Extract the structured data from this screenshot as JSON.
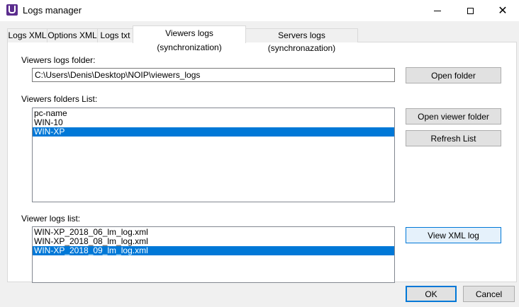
{
  "window": {
    "title": "Logs manager",
    "controls": {
      "minimize": "minimize",
      "maximize": "maximize",
      "close": "✕"
    }
  },
  "tabs": [
    {
      "label": "Logs XML"
    },
    {
      "label": "Options XML"
    },
    {
      "label": "Logs txt"
    },
    {
      "label": "Viewers logs (synchronization)",
      "active": true
    },
    {
      "label": "Servers logs (synchronazation)"
    }
  ],
  "viewers_tab": {
    "folder_label": "Viewers logs folder:",
    "folder_path": "C:\\Users\\Denis\\Desktop\\NOIP\\viewers_logs",
    "open_folder_button": "Open folder",
    "folders_list_label": "Viewers folders List:",
    "folders": [
      "pc-name",
      "WIN-10",
      "WIN-XP"
    ],
    "selected_folder": "WIN-XP",
    "open_viewer_folder_button": "Open viewer folder",
    "refresh_list_button": "Refresh List",
    "logs_list_label": "Viewer logs list:",
    "logs": [
      "WIN-XP_2018_06_lm_log.xml",
      "WIN-XP_2018_08_lm_log.xml",
      "WIN-XP_2018_09_lm_log.xml"
    ],
    "selected_log": "WIN-XP_2018_09_lm_log.xml",
    "view_xml_log_button": "View XML log"
  },
  "footer": {
    "ok_button": "OK",
    "cancel_button": "Cancel"
  },
  "colors": {
    "selection": "#0078d7",
    "accent": "#5b2d8e"
  }
}
